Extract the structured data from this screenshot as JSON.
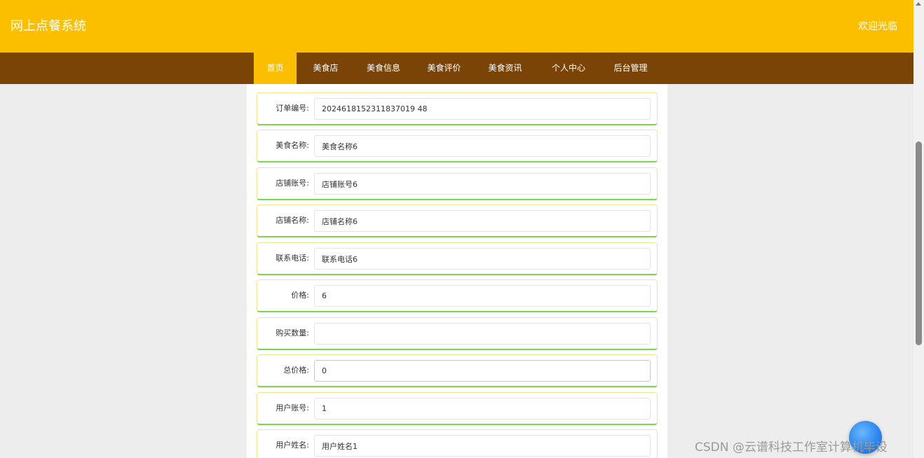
{
  "header": {
    "site_title": "网上点餐系统",
    "welcome": "欢迎光临"
  },
  "nav": {
    "items": [
      {
        "label": "首页",
        "active": true
      },
      {
        "label": "美食店"
      },
      {
        "label": "美食信息"
      },
      {
        "label": "美食评价"
      },
      {
        "label": "美食资讯"
      },
      {
        "label": "个人中心"
      },
      {
        "label": "后台管理"
      }
    ]
  },
  "form": {
    "fields": [
      {
        "label": "订单编号:",
        "value": "2024618152311837019 48"
      },
      {
        "label": "美食名称:",
        "value": "美食名称6"
      },
      {
        "label": "店铺账号:",
        "value": "店铺账号6"
      },
      {
        "label": "店铺名称:",
        "value": "店铺名称6"
      },
      {
        "label": "联系电话:",
        "value": "联系电话6"
      },
      {
        "label": "价格:",
        "value": "6"
      },
      {
        "label": "购买数量:",
        "value": ""
      },
      {
        "label": "总价格:",
        "value": "0"
      },
      {
        "label": "用户账号:",
        "value": "1"
      },
      {
        "label": "用户姓名:",
        "value": "用户姓名1"
      }
    ]
  },
  "watermark": "CSDN @云谱科技工作室计算机毕设",
  "colors": {
    "header": "#fcbf00",
    "navbar": "#7a4406",
    "active_tab": "#fcbf00",
    "row_border_top": "#f5e48e",
    "row_border_bottom": "#7bd84a"
  },
  "icons": {
    "float_button": "blue-circle-icon"
  }
}
